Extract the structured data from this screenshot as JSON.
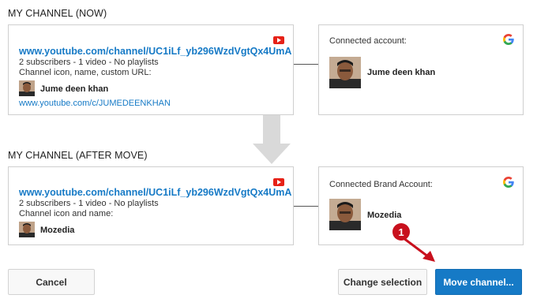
{
  "now_section": {
    "title": "MY CHANNEL (NOW)",
    "channel_url": "www.youtube.com/channel/UC1iLf_yb296WzdVgtQx4UmA",
    "stats": "2 subscribers - 1 video - No playlists",
    "details_label": "Channel icon, name, custom URL:",
    "channel_name": "Jume deen khan",
    "custom_url": "www.youtube.com/c/JUMEDEENKHAN",
    "account_label": "Connected account:",
    "account_name": "Jume deen khan"
  },
  "after_section": {
    "title": "MY CHANNEL (AFTER MOVE)",
    "channel_url": "www.youtube.com/channel/UC1iLf_yb296WzdVgtQx4UmA",
    "stats": "2 subscribers - 1 video - No playlists",
    "details_label": "Channel icon and name:",
    "channel_name": "Mozedia",
    "account_label": "Connected Brand Account:",
    "account_name": "Mozedia"
  },
  "buttons": {
    "cancel": "Cancel",
    "change_selection": "Change selection",
    "move_channel": "Move channel..."
  },
  "annotation": {
    "step_number": "1",
    "color": "#c8101d"
  },
  "colors": {
    "link": "#167ac6",
    "primary_button": "#167ac6",
    "youtube_red": "#e62117"
  },
  "icons": [
    "youtube-icon",
    "google-icon",
    "down-arrow-icon",
    "red-arrow-icon"
  ]
}
